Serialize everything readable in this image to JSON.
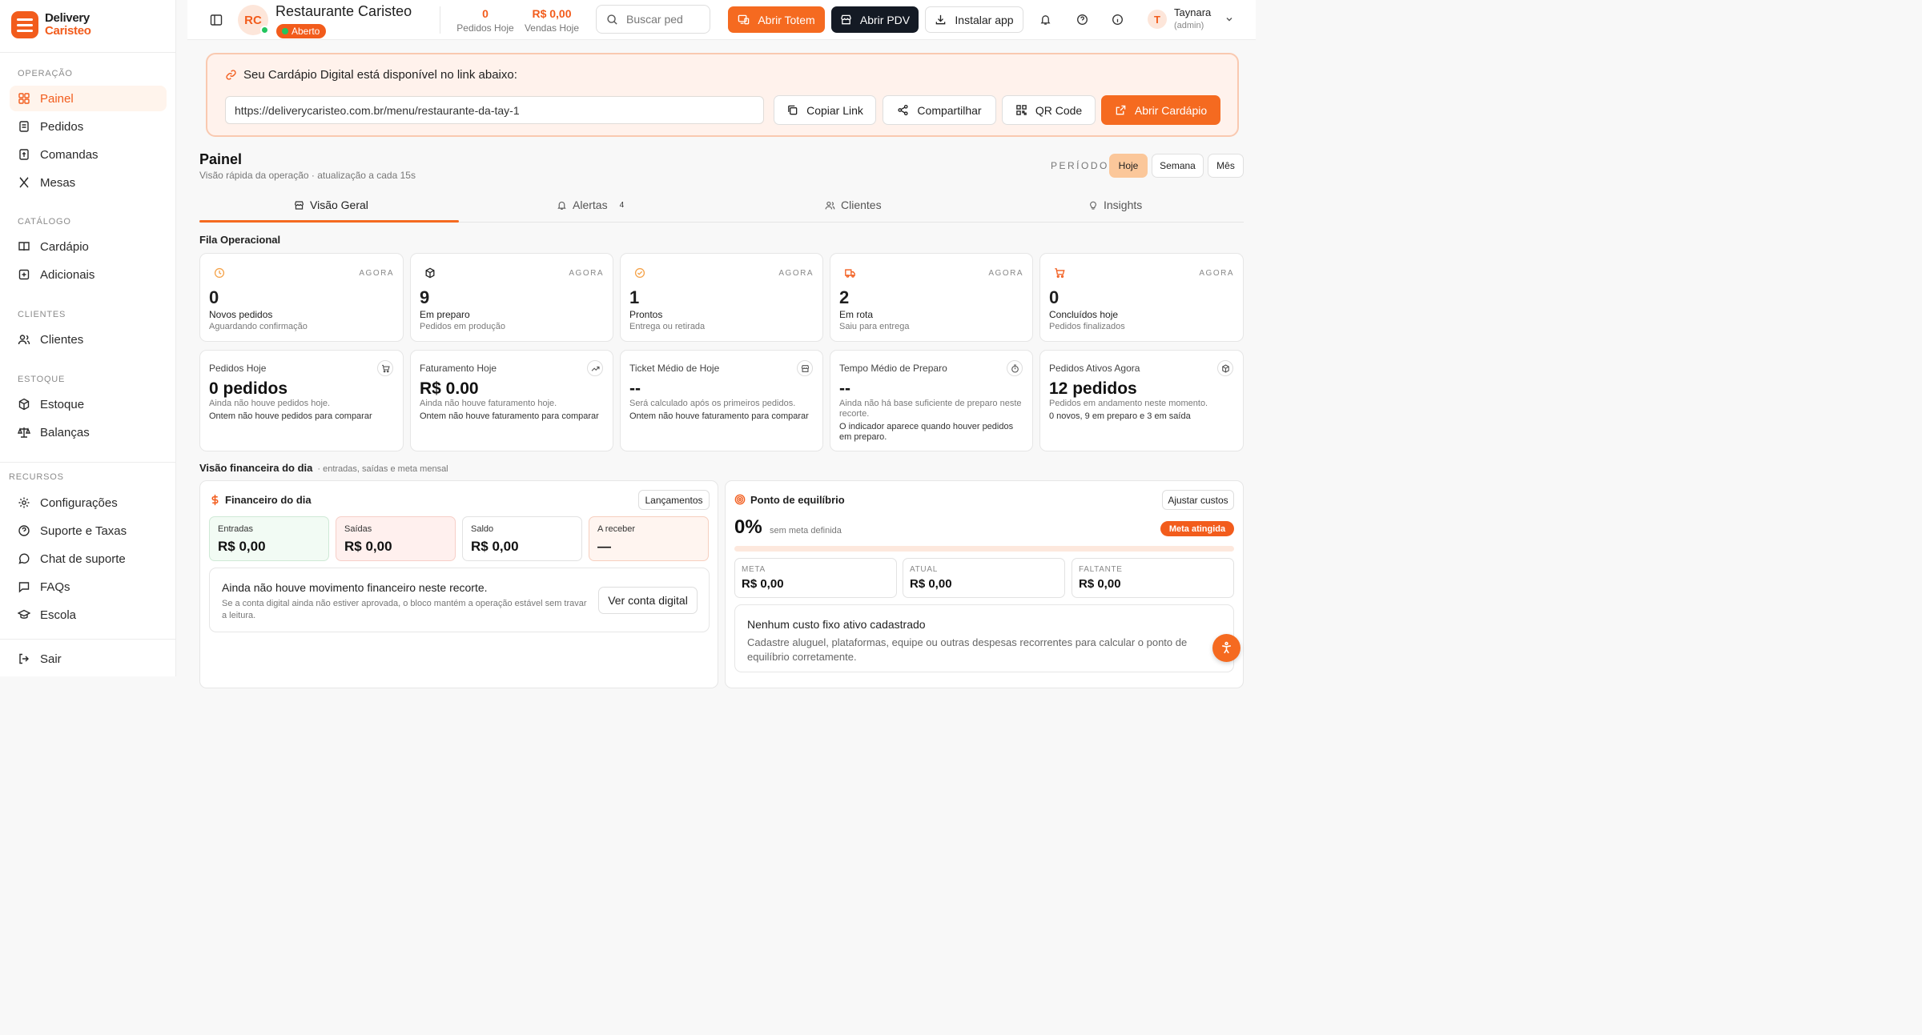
{
  "brand": {
    "line1": "Delivery",
    "line2": "Caristeo"
  },
  "sidebar": {
    "sections": [
      {
        "title": "OPERAÇÃO",
        "items": [
          {
            "label": "Painel",
            "icon": "grid-icon",
            "active": true
          },
          {
            "label": "Pedidos",
            "icon": "receipt-icon"
          },
          {
            "label": "Comandas",
            "icon": "ticket-icon"
          },
          {
            "label": "Mesas",
            "icon": "utensils-icon"
          }
        ]
      },
      {
        "title": "CATÁLOGO",
        "items": [
          {
            "label": "Cardápio",
            "icon": "book-icon"
          },
          {
            "label": "Adicionais",
            "icon": "plus-square-icon"
          }
        ]
      },
      {
        "title": "CLIENTES",
        "items": [
          {
            "label": "Clientes",
            "icon": "users-icon"
          }
        ]
      },
      {
        "title": "ESTOQUE",
        "items": [
          {
            "label": "Estoque",
            "icon": "package-icon"
          },
          {
            "label": "Balanças",
            "icon": "scale-icon"
          }
        ]
      },
      {
        "title": "RECURSOS",
        "items": [
          {
            "label": "Configurações",
            "icon": "gear-icon"
          },
          {
            "label": "Suporte e Taxas",
            "icon": "help-icon"
          },
          {
            "label": "Chat de suporte",
            "icon": "chat-icon"
          },
          {
            "label": "FAQs",
            "icon": "message-icon"
          },
          {
            "label": "Escola",
            "icon": "graduation-icon"
          }
        ]
      }
    ],
    "logout": "Sair"
  },
  "topbar": {
    "initials": "RC",
    "restaurant": "Restaurante Caristeo",
    "status": "Aberto",
    "orders_today_value": "0",
    "orders_today_label": "Pedidos Hoje",
    "sales_today_value": "R$ 0,00",
    "sales_today_label": "Vendas Hoje",
    "search_placeholder": "Buscar ped",
    "btn_totem": "Abrir Totem",
    "btn_pdv": "Abrir PDV",
    "btn_install": "Instalar app",
    "user_initial": "T",
    "user_name": "Taynara",
    "user_role": "(admin)"
  },
  "banner": {
    "title": "Seu Cardápio Digital está disponível no link abaixo:",
    "url": "https://deliverycaristeo.com.br/menu/restaurante-da-tay-1",
    "copy": "Copiar Link",
    "share": "Compartilhar",
    "qr": "QR Code",
    "open": "Abrir Cardápio"
  },
  "panel": {
    "title": "Painel",
    "subtitle": "Visão rápida da operação · atualização a cada 15s",
    "period_label": "PERÍODO",
    "periods": [
      "Hoje",
      "Semana",
      "Mês"
    ],
    "active_period": "Hoje"
  },
  "tabs": [
    {
      "label": "Visão Geral",
      "active": true
    },
    {
      "label": "Alertas",
      "badge": "4"
    },
    {
      "label": "Clientes"
    },
    {
      "label": "Insights"
    }
  ],
  "queue": {
    "title": "Fila Operacional",
    "tag": "AGORA",
    "cards": [
      {
        "value": "0",
        "label": "Novos pedidos",
        "sub": "Aguardando confirmação",
        "icon": "clock-icon"
      },
      {
        "value": "9",
        "label": "Em preparo",
        "sub": "Pedidos em produção",
        "icon": "box-icon"
      },
      {
        "value": "1",
        "label": "Prontos",
        "sub": "Entrega ou retirada",
        "icon": "check-circle-icon"
      },
      {
        "value": "2",
        "label": "Em rota",
        "sub": "Saiu para entrega",
        "icon": "truck-icon"
      },
      {
        "value": "0",
        "label": "Concluídos hoje",
        "sub": "Pedidos finalizados",
        "icon": "cart-icon"
      }
    ]
  },
  "kpis": [
    {
      "label": "Pedidos Hoje",
      "value": "0 pedidos",
      "l1": "Ainda não houve pedidos hoje.",
      "l2": "Ontem não houve pedidos para comparar",
      "icon": "cart-icon"
    },
    {
      "label": "Faturamento Hoje",
      "value": "R$ 0.00",
      "l1": "Ainda não houve faturamento hoje.",
      "l2": "Ontem não houve faturamento para comparar",
      "icon": "trend-up-icon"
    },
    {
      "label": "Ticket Médio de Hoje",
      "value": "--",
      "l1": "Será calculado após os primeiros pedidos.",
      "l2": "Ontem não houve faturamento para comparar",
      "icon": "store-icon"
    },
    {
      "label": "Tempo Médio de Preparo",
      "value": "--",
      "l1": "Ainda não há base suficiente de preparo neste recorte.",
      "l2": "O indicador aparece quando houver pedidos em preparo.",
      "icon": "timer-icon"
    },
    {
      "label": "Pedidos Ativos Agora",
      "value": "12 pedidos",
      "l1": "Pedidos em andamento neste momento.",
      "l2": "0 novos, 9 em preparo e 3 em saída",
      "icon": "box-icon"
    }
  ],
  "finance": {
    "section_title": "Visão financeira do dia",
    "section_sub": "· entradas, saídas e meta mensal",
    "title": "Financeiro do dia",
    "btn": "Lançamentos",
    "boxes": [
      {
        "label": "Entradas",
        "value": "R$ 0,00"
      },
      {
        "label": "Saídas",
        "value": "R$ 0,00"
      },
      {
        "label": "Saldo",
        "value": "R$ 0,00"
      },
      {
        "label": "A receber",
        "value": "—"
      }
    ],
    "empty_title": "Ainda não houve movimento financeiro neste recorte.",
    "empty_text": "Se a conta digital ainda não estiver aprovada, o bloco mantém a operação estável sem travar a leitura.",
    "empty_btn": "Ver conta digital"
  },
  "breakeven": {
    "title": "Ponto de equilíbrio",
    "btn": "Ajustar custos",
    "percent": "0%",
    "percent_note": "sem meta definida",
    "badge": "Meta atingida",
    "progress_fraction": 0,
    "boxes": [
      {
        "label": "META",
        "value": "R$ 0,00"
      },
      {
        "label": "ATUAL",
        "value": "R$ 0,00"
      },
      {
        "label": "FALTANTE",
        "value": "R$ 0,00"
      }
    ],
    "empty_title": "Nenhum custo fixo ativo cadastrado",
    "empty_text": "Cadastre aluguel, plataformas, equipe ou outras despesas recorrentes para calcular o ponto de equilíbrio corretamente."
  },
  "colors": {
    "accent": "#f56a20",
    "dark": "#141a24",
    "status_green": "#22c55e"
  }
}
